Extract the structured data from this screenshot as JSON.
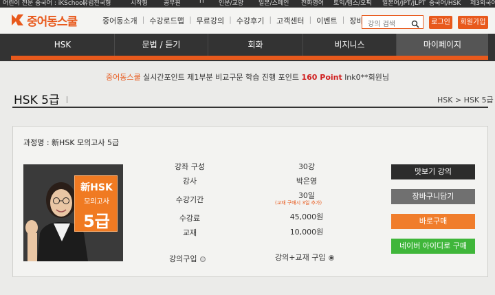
{
  "top_strip": {
    "left_text": "어린이 전문 중국어 : iKSchool",
    "items": [
      "유럽전국형",
      "시작형",
      "공무원",
      "IT",
      "인문/교양",
      "일본/스페인",
      "전화영어",
      "토익/텝스/오픽",
      "일본어/JPT/JLPT",
      "중국어/HSK",
      "제3외국어"
    ]
  },
  "header": {
    "logo_text": "중어동스쿨",
    "nav": [
      "중어동소개",
      "수강로드맵",
      "무료강의",
      "수강후기",
      "고객센터",
      "이벤트",
      "장바구니"
    ],
    "search_placeholder": "강의 검색",
    "login_label": "로그인",
    "join_label": "회원가입"
  },
  "main_nav": {
    "tabs": [
      "HSK",
      "문법 / 듣기",
      "회화",
      "비지니스",
      "마이페이지"
    ],
    "active_index": 4
  },
  "point_banner": {
    "site": "중어동스쿨",
    "text": "실시간포인트 제1부분 비교구문 학습 진행 포인트",
    "points": "160 Point",
    "user": "lnk0**회원님"
  },
  "page": {
    "title": "HSK 5급",
    "breadcrumb": "HSK > HSK 5급"
  },
  "course": {
    "label": "과정명 : 新HSK 모의고사 5급",
    "thumb": {
      "line1": "新HSK",
      "line2": "모의고사",
      "line3": "5급"
    },
    "info": [
      {
        "label": "강좌 구성",
        "value": "30강"
      },
      {
        "label": "강사",
        "value": "박은영"
      },
      {
        "label": "수강기간",
        "value": "30일"
      },
      {
        "label": "수강료",
        "value": "45,000원"
      },
      {
        "label": "교재",
        "value": "10,000원"
      }
    ],
    "period_note": "(교재 구매시 3일 추가)",
    "options": [
      {
        "label": "강의구입",
        "selected": false
      },
      {
        "label": "강의+교재 구입",
        "selected": true
      }
    ],
    "buttons": {
      "preview": "맛보기 강의",
      "cart": "장바구니담기",
      "buy": "바로구매",
      "naver": "네이버 아이디로 구매"
    }
  },
  "colors": {
    "accent": "#e8591c",
    "nav_bg": "#333333",
    "btn_dark": "#2c2c2c",
    "btn_gray": "#707070",
    "btn_orange": "#f07d2c",
    "btn_green": "#3fb63a"
  }
}
